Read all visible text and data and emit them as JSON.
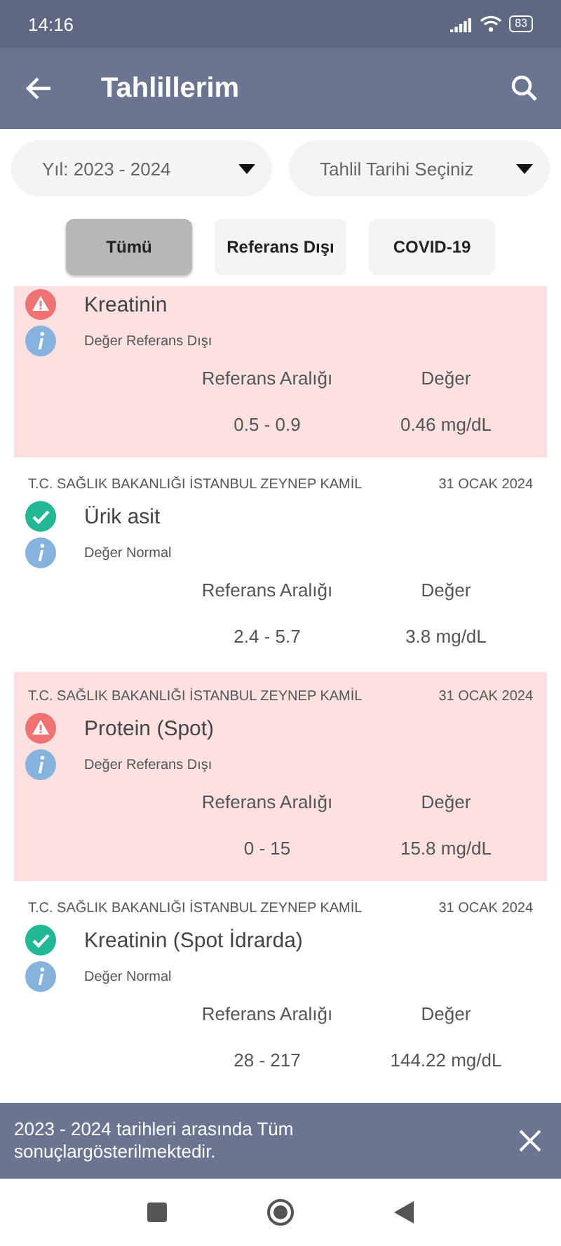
{
  "status_bar": {
    "time": "14:16",
    "battery": "83"
  },
  "app_bar": {
    "title": "Tahlillerim"
  },
  "filters": [
    {
      "kind": "dropdown",
      "label": "Yıl: 2023 - 2024"
    },
    {
      "kind": "dropdown",
      "label": "Tahlil Tarihi Seçiniz"
    }
  ],
  "tabs": [
    {
      "label": "Tümü",
      "selected": true
    },
    {
      "label": "Referans Dışı",
      "selected": false
    },
    {
      "label": "COVID-19",
      "selected": false
    }
  ],
  "results": [
    {
      "out_of_range": true,
      "name": "Kreatinin",
      "note": "Değer Referans Dışı",
      "range_label": "Referans Aralığı",
      "value_label": "Değer",
      "range": "0.5 - 0.9",
      "value": "0.46 mg/dL"
    },
    {
      "out_of_range": false,
      "hospital": "T.C. SAĞLIK BAKANLIĞI İSTANBUL ZEYNEP KAMİL",
      "date": "31 OCAK 2024",
      "name": "Ürik asit",
      "note": "Değer Normal",
      "range_label": "Referans Aralığı",
      "value_label": "Değer",
      "range": "2.4 - 5.7",
      "value": "3.8 mg/dL"
    },
    {
      "out_of_range": true,
      "hospital": "T.C. SAĞLIK BAKANLIĞI İSTANBUL ZEYNEP KAMİL",
      "date": "31 OCAK 2024",
      "name": "Protein (Spot)",
      "note": "Değer Referans Dışı",
      "range_label": "Referans Aralığı",
      "value_label": "Değer",
      "range": "0 - 15",
      "value": "15.8 mg/dL"
    },
    {
      "out_of_range": false,
      "hospital": "T.C. SAĞLIK BAKANLIĞI İSTANBUL ZEYNEP KAMİL",
      "date": "31 OCAK 2024",
      "name": "Kreatinin (Spot İdrarda)",
      "note": "Değer Normal",
      "range_label": "Referans Aralığı",
      "value_label": "Değer",
      "range": "28 - 217",
      "value": "144.22 mg/dL"
    }
  ],
  "banner": {
    "message": "2023 - 2024 tarihleri arasında Tüm sonuçlargösterilmektedir."
  }
}
